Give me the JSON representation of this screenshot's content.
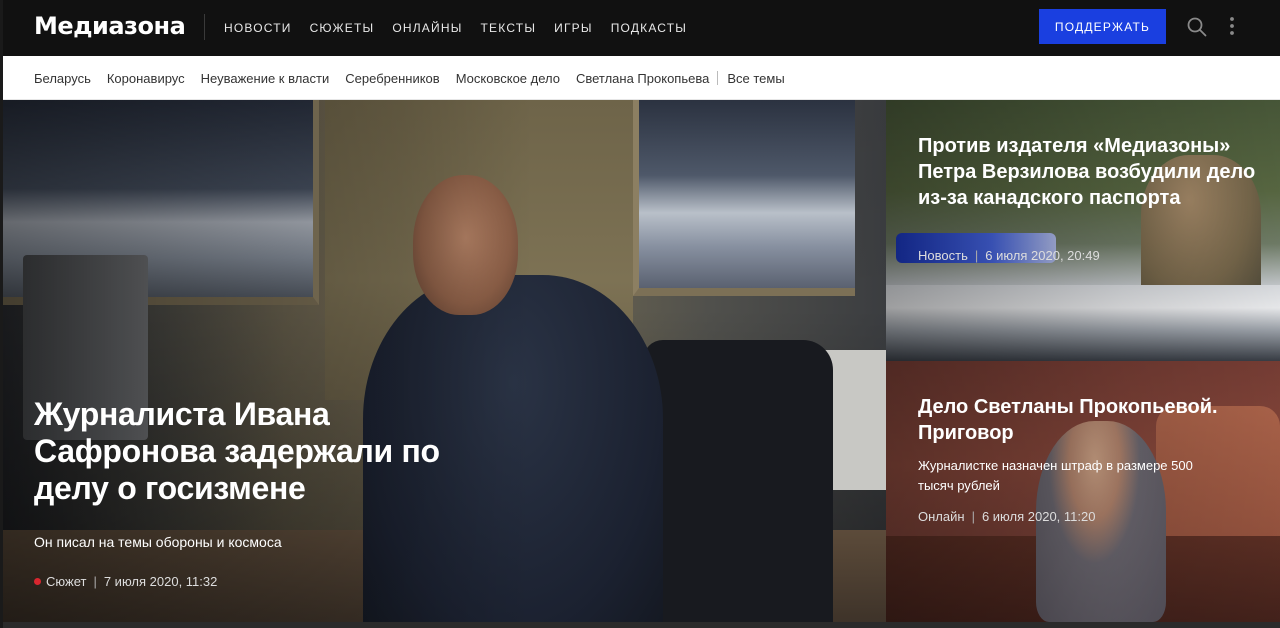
{
  "header": {
    "logo": "Медиазона",
    "nav": [
      "Новости",
      "Сюжеты",
      "Онлайны",
      "Тексты",
      "Игры",
      "Подкасты"
    ],
    "support_label": "Поддержать"
  },
  "topics": {
    "items": [
      "Беларусь",
      "Коронавирус",
      "Неуважение к власти",
      "Серебренников",
      "Московское дело",
      "Светлана Прокопьева"
    ],
    "all_label": "Все темы"
  },
  "hero": {
    "title": "Журналиста Ивана Сафронова задержали по делу о госизмене",
    "lead": "Он писал на темы обороны и космоса",
    "kind": "Сюжет",
    "date": "7 июля 2020, 11:32",
    "kind_dot_color": "#d8262f"
  },
  "cards": [
    {
      "title": "Против издателя «Медиазоны» Петра Верзилова возбудили дело из-за канадского паспорта",
      "lead": "",
      "kind": "Новость",
      "date": "6 июля 2020, 20:49"
    },
    {
      "title": "Дело Светланы Прокопьевой. Приговор",
      "lead": "Журналистке назначен штраф в размере 500 тысяч рублей",
      "kind": "Онлайн",
      "date": "6 июля 2020, 11:20"
    }
  ],
  "colors": {
    "topbar_bg": "#111111",
    "support_bg": "#1a3fe0",
    "topicbar_bg": "#ffffff"
  }
}
